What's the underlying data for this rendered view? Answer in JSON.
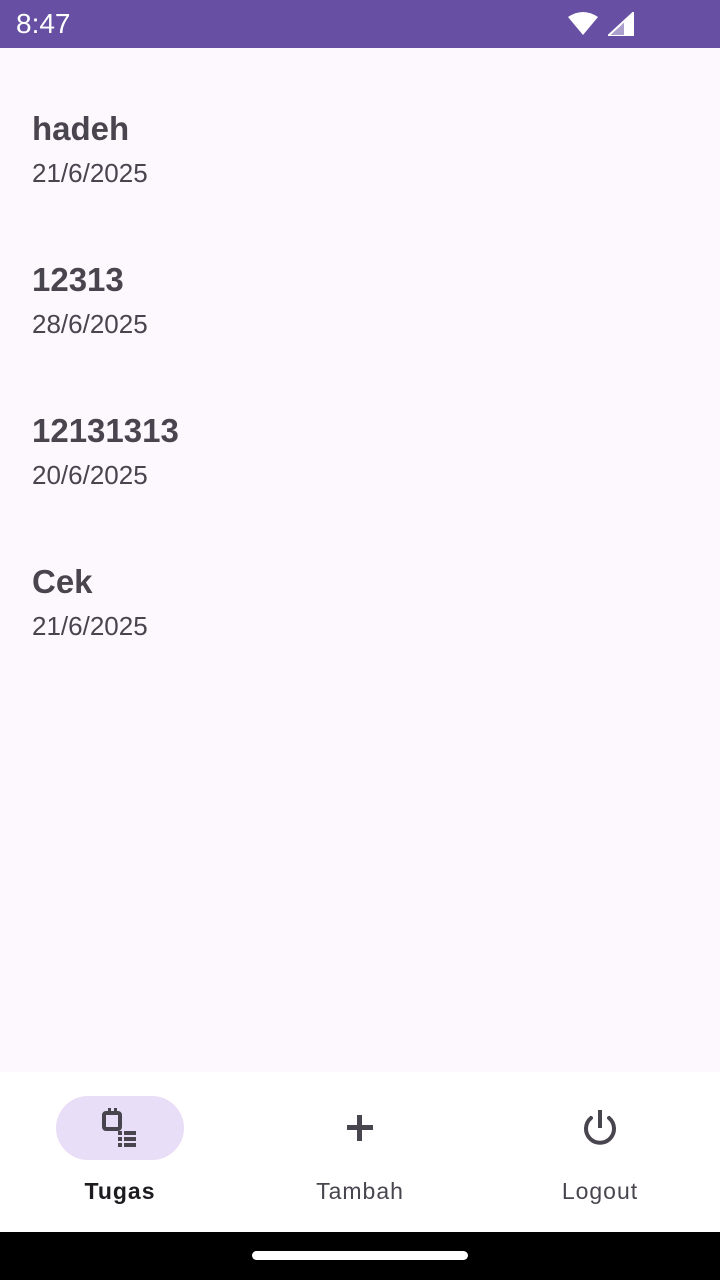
{
  "status_bar": {
    "time": "8:47",
    "background": "#6750a4",
    "icons": [
      "wifi-icon",
      "cellular-signal-icon"
    ]
  },
  "tasks": [
    {
      "title": "hadeh",
      "date": "21/6/2025"
    },
    {
      "title": "12313",
      "date": "28/6/2025"
    },
    {
      "title": "12131313",
      "date": "20/6/2025"
    },
    {
      "title": "Cek",
      "date": "21/6/2025"
    }
  ],
  "bottom_nav": {
    "items": [
      {
        "label": "Tugas",
        "icon": "task-list-icon",
        "active": true
      },
      {
        "label": "Tambah",
        "icon": "plus-icon",
        "active": false
      },
      {
        "label": "Logout",
        "icon": "power-icon",
        "active": false
      }
    ],
    "indicator_color": "#e8def8"
  },
  "colors": {
    "accent": "#6750a4",
    "background": "#fdf7fe",
    "text": "#49454f"
  }
}
